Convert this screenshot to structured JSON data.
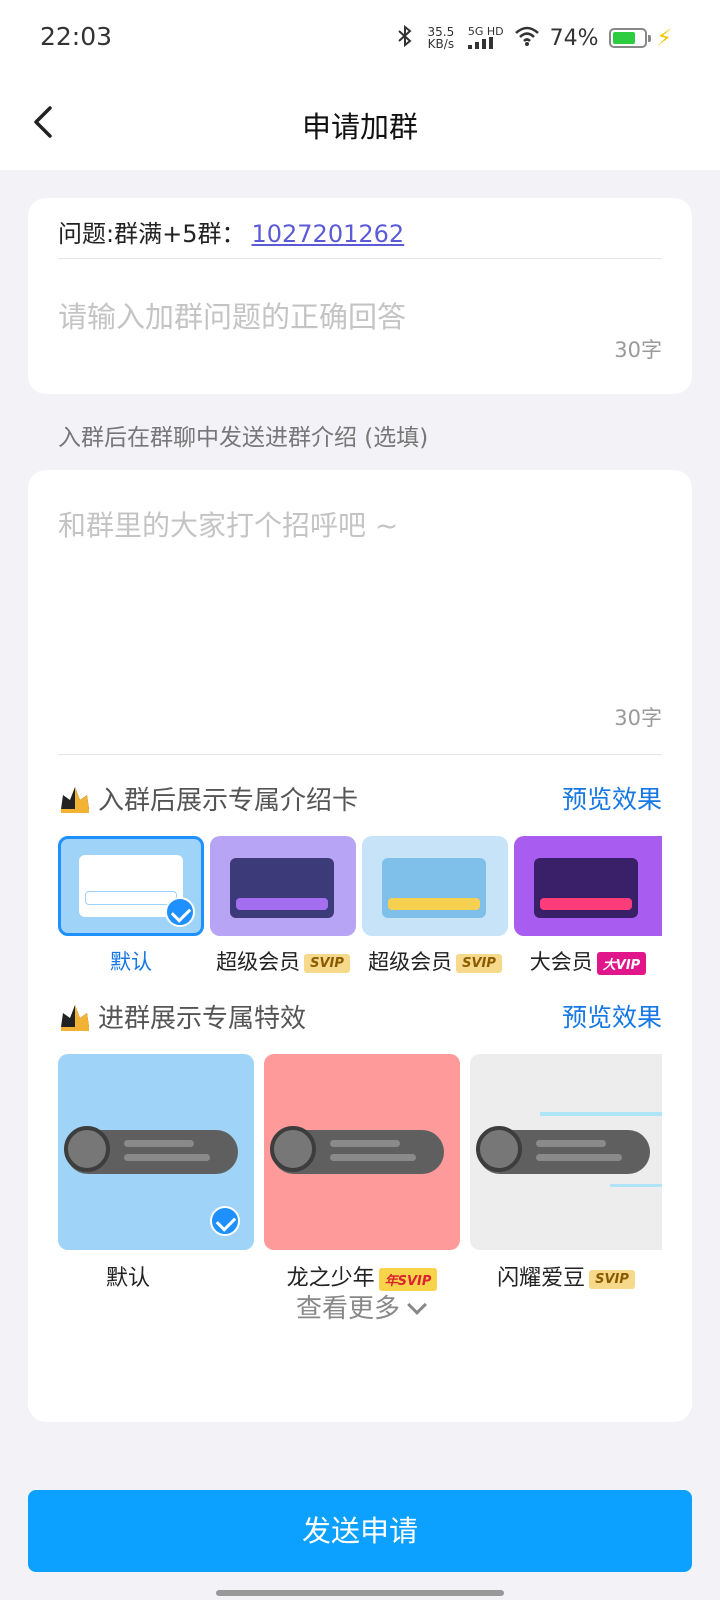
{
  "status_bar": {
    "time": "22:03",
    "speed_value": "35.5",
    "speed_unit": "KB/s",
    "net_label": "5G HD",
    "battery": "74%",
    "icons": [
      "bluetooth-icon",
      "signal-icon",
      "wifi-icon",
      "battery-icon",
      "charging-icon"
    ]
  },
  "header": {
    "title": "申请加群",
    "back_icon": "chevron-left-icon"
  },
  "question_card": {
    "question_label": "问题:群满+5群：",
    "question_link": "1027201262",
    "answer_placeholder": "请输入加群问题的正确回答",
    "char_count": "30字"
  },
  "intro_note": "入群后在群聊中发送进群介绍 (选填)",
  "intro_card": {
    "placeholder": "和群里的大家打个招呼吧 ~",
    "char_count": "30字",
    "intro_section": {
      "title": "入群后展示专属介绍卡",
      "preview": "预览效果",
      "options": [
        {
          "label": "默认",
          "tag": "",
          "selected": true,
          "bg": "#9fd3f7"
        },
        {
          "label": "超级会员",
          "tag": "SVIP",
          "selected": false,
          "bg": "#b7a4f5"
        },
        {
          "label": "超级会员",
          "tag": "SVIP",
          "selected": false,
          "bg": "#c6e3f8"
        },
        {
          "label": "大会员",
          "tag": "大VIP",
          "selected": false,
          "bg": "#a95cf0"
        }
      ]
    },
    "effect_section": {
      "title": "进群展示专属特效",
      "preview": "预览效果",
      "options": [
        {
          "label": "默认",
          "tag": "",
          "selected": true,
          "bg": "#9fd3f7"
        },
        {
          "label": "龙之少年",
          "tag": "年SVIP",
          "selected": false,
          "bg": "#ff9a9a"
        },
        {
          "label": "闪耀爱豆",
          "tag": "SVIP",
          "selected": false,
          "bg": "#ededee"
        }
      ]
    },
    "see_more": "查看更多"
  },
  "send_button": "发送申请",
  "colors": {
    "accent": "#0ca0ff",
    "link": "#5b5bd6",
    "preview": "#1677e6"
  }
}
